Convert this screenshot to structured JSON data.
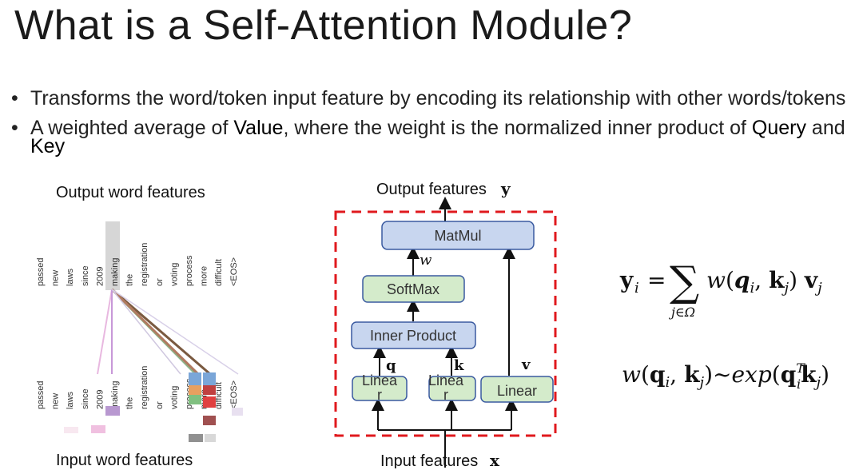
{
  "slide": {
    "title": "What is a Self-Attention Module?",
    "bullets": [
      {
        "text": "Transforms the word/token input feature by encoding its relationship with other words/tokens"
      },
      {
        "parts": [
          "A weighted average of ",
          "Value",
          ", where the weight is the normalized inner product of ",
          "Query",
          " and ",
          "Key"
        ]
      }
    ]
  },
  "attention_viz": {
    "output_caption": "Output word features",
    "input_caption": "Input word features",
    "tokens": [
      "passed",
      "new",
      "laws",
      "since",
      "2009",
      "making",
      "the",
      "registration",
      "or",
      "voting",
      "process",
      "more",
      "difficult",
      "<EOS>"
    ],
    "highlight_token": "making"
  },
  "diagram": {
    "output_label": "Output features",
    "output_symbol": "y",
    "input_label": "Input features",
    "input_symbol": "x",
    "matmul": "MatMul",
    "softmax": "SoftMax",
    "inner_product": "Inner Product",
    "linear": "Linear",
    "linear_q_visible": "Linea",
    "linear_q_wrap": "r",
    "w_label": "w",
    "q_label": "q",
    "k_label": "k",
    "v_label": "v",
    "colors": {
      "box_blue": "#c8d6ef",
      "box_green": "#d4ebcb",
      "dash_red": "#e0191e",
      "box_border": "#3a5aa0",
      "green_border": "#5a8a4a"
    }
  },
  "equations": {
    "eq1_lhs": "y",
    "eq1_sub": "i",
    "eq1_sum_sub": "j∈Ω",
    "eq2": "w(qᵢ, kⱼ)~exp(qᵢᵀkⱼ)"
  }
}
